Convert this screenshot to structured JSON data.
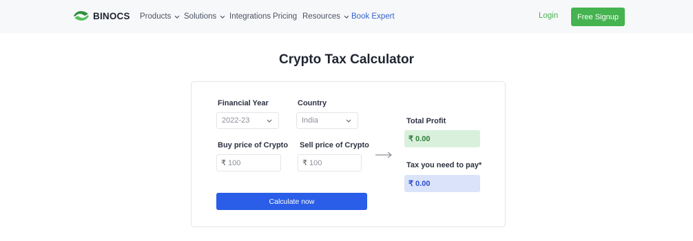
{
  "nav": {
    "brand": "BINOCS",
    "items": [
      "Products",
      "Solutions",
      "Integrations",
      "Pricing",
      "Resources",
      "Book Expert"
    ],
    "login": "Login",
    "signup": "Free Signup"
  },
  "page": {
    "title": "Crypto Tax Calculator"
  },
  "form": {
    "financial_year_label": "Financial Year",
    "financial_year_value": "2022-23",
    "country_label": "Country",
    "country_value": "India",
    "buy_label": "Buy price of Crypto",
    "buy_currency": "₹",
    "buy_placeholder": "100",
    "sell_label": "Sell price of Crypto",
    "sell_currency": "₹",
    "sell_placeholder": "100",
    "calculate": "Calculate now"
  },
  "results": {
    "profit_label": "Total Profit",
    "profit_value": "₹ 0.00",
    "tax_label": "Tax you need to pay*",
    "tax_value": "₹ 0.00"
  },
  "colors": {
    "brand_green": "#45b34f",
    "primary_blue": "#2a5ee8",
    "accent_link": "#3563c9",
    "profit_bg": "#d9f1dc",
    "tax_bg": "#dbe3fb"
  },
  "icons": [
    "binocs-logo-icon",
    "chevron-down-icon",
    "arrow-right-icon"
  ]
}
